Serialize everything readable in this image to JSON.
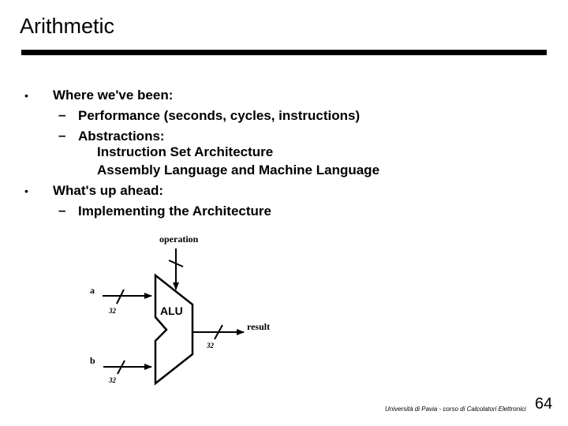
{
  "slide": {
    "title": "Arithmetic",
    "bullets": [
      {
        "text": "Where we've been:",
        "sub": [
          {
            "text": "Performance (seconds, cycles, instructions)"
          },
          {
            "text": "Abstractions:",
            "lines": [
              "Instruction Set Architecture",
              "Assembly Language and Machine Language"
            ]
          }
        ]
      },
      {
        "text": "What's up ahead:",
        "sub": [
          {
            "text": "Implementing the Architecture"
          }
        ]
      }
    ],
    "bullet_glyph": "•",
    "dash_glyph": "–"
  },
  "diagram": {
    "block_label": "ALU",
    "operation_label": "operation",
    "input_a_label": "a",
    "input_b_label": "b",
    "output_label": "result",
    "width_a": "32",
    "width_b": "32",
    "width_result": "32"
  },
  "footer": {
    "text": "Università di Pavia - corso di Calcolatori Elettronici",
    "page_number": "64"
  }
}
